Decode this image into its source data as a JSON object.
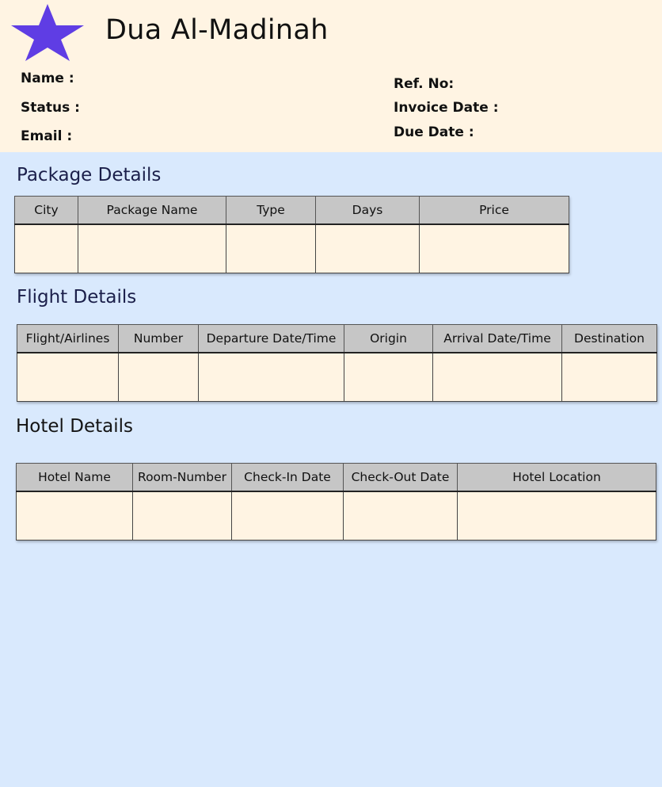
{
  "header": {
    "company_name": "Dua Al-Madinah",
    "logo_icon": "star-icon",
    "logo_color": "#5f3de4",
    "fields_left": {
      "name": "Name :",
      "status": "Status :",
      "email": "Email :"
    },
    "fields_right": {
      "ref_no": "Ref. No:",
      "invoice_date": "Invoice Date :",
      "due_date": "Due Date :"
    }
  },
  "package_details": {
    "title": "Package Details",
    "columns": [
      "City",
      "Package Name",
      "Type",
      "Days",
      "Price"
    ]
  },
  "flight_details": {
    "title": "Flight Details",
    "columns": [
      "Flight/Airlines",
      "Number",
      "Departure Date/Time",
      "Origin",
      "Arrival Date/Time",
      "Destination"
    ]
  },
  "hotel_details": {
    "title": "Hotel Details",
    "columns": [
      "Hotel Name",
      "Room-Number",
      "Check-In Date",
      "Check-Out Date",
      "Hotel Location"
    ]
  },
  "colors": {
    "page_background": "#d9e9fd",
    "panel_background": "#fff4e3",
    "table_header": "#c6c6c6"
  }
}
